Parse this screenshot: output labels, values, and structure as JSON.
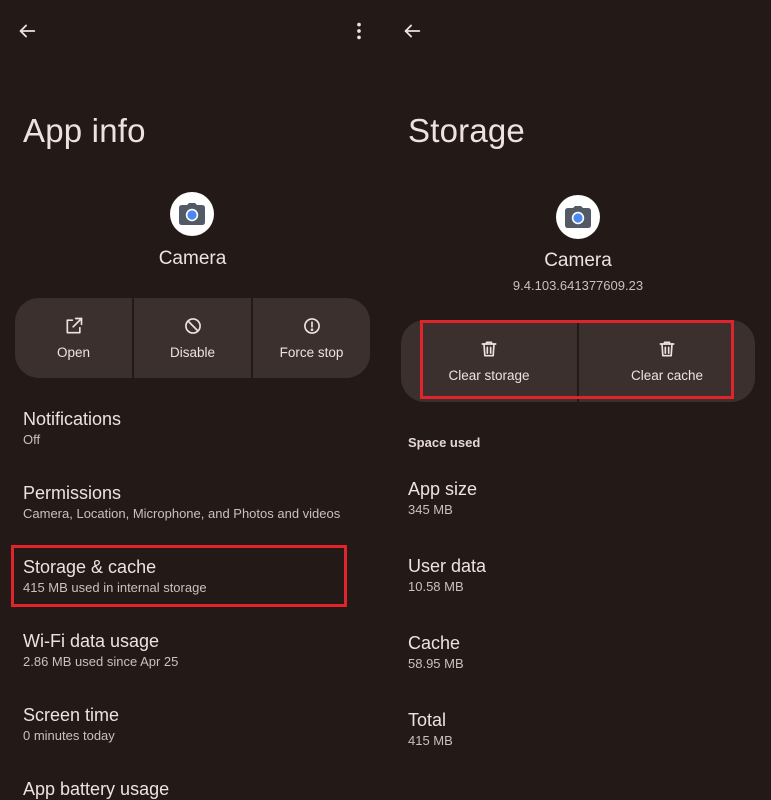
{
  "left": {
    "title": "App info",
    "app_name": "Camera",
    "actions": [
      {
        "label": "Open",
        "icon": "open-external-icon"
      },
      {
        "label": "Disable",
        "icon": "disable-icon"
      },
      {
        "label": "Force stop",
        "icon": "alert-icon"
      }
    ],
    "items": [
      {
        "title": "Notifications",
        "subtitle": "Off"
      },
      {
        "title": "Permissions",
        "subtitle": "Camera, Location, Microphone, and Photos and videos"
      },
      {
        "title": "Storage & cache",
        "subtitle": "415 MB used in internal storage"
      },
      {
        "title": "Wi-Fi data usage",
        "subtitle": "2.86 MB used since Apr 25"
      },
      {
        "title": "Screen time",
        "subtitle": "0 minutes today"
      },
      {
        "title": "App battery usage",
        "subtitle": ""
      }
    ]
  },
  "right": {
    "title": "Storage",
    "app_name": "Camera",
    "app_version": "9.4.103.641377609.23",
    "actions": [
      {
        "label": "Clear storage",
        "icon": "trash-icon"
      },
      {
        "label": "Clear cache",
        "icon": "trash-icon"
      }
    ],
    "section_label": "Space used",
    "items": [
      {
        "title": "App size",
        "subtitle": "345 MB"
      },
      {
        "title": "User data",
        "subtitle": "10.58 MB"
      },
      {
        "title": "Cache",
        "subtitle": "58.95 MB"
      },
      {
        "title": "Total",
        "subtitle": "415 MB"
      }
    ]
  },
  "colors": {
    "background": "#231a18",
    "card": "#3b302d",
    "highlight": "#e0242b",
    "camera_icon_blue": "#4a89f3"
  }
}
